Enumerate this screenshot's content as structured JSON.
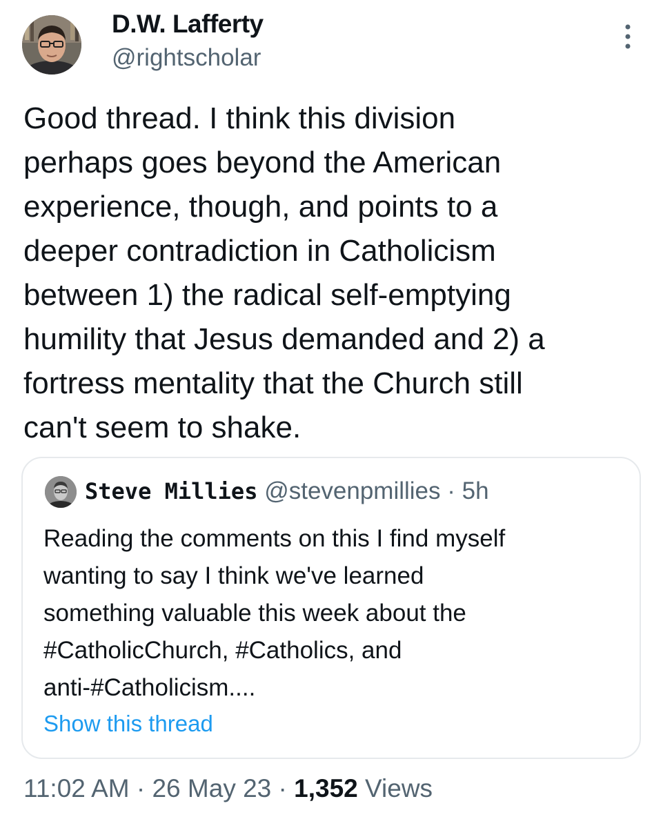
{
  "author": {
    "display_name": "D.W. Lafferty",
    "handle": "@rightscholar"
  },
  "tweet": {
    "text": "Good thread. I think this division\nperhaps goes beyond the American\nexperience, though, and points to a\ndeeper contradiction in Catholicism\nbetween 1) the radical self-emptying\nhumility that Jesus demanded and 2) a\nfortress mentality that the Church still\ncan't seem to shake."
  },
  "quoted_tweet": {
    "display_name": "Steve Millies",
    "handle": "@stevenpmillies",
    "separator": "·",
    "time_ago": "5h",
    "text": "Reading the comments on this I find myself\nwanting to say I think we've learned\nsomething valuable this week about the\n#CatholicChurch, #Catholics, and\nanti-#Catholicism....",
    "show_thread_label": "Show this thread"
  },
  "footer": {
    "time": "11:02 AM",
    "separator_1": "·",
    "date": "26 May 23",
    "separator_2": "·",
    "views_count": "1,352",
    "views_label": "Views"
  },
  "icons": {
    "more": "more-vertical-icon"
  },
  "colors": {
    "link": "#1d9bf0",
    "secondary_text": "#536471",
    "primary_text": "#0f1419",
    "border": "#e6e9ec"
  }
}
